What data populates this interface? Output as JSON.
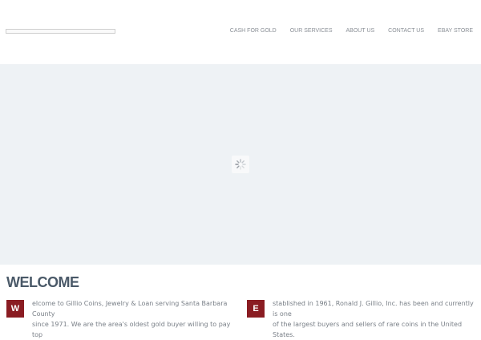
{
  "nav": {
    "items": [
      "CASH FOR GOLD",
      "OUR SERVICES",
      "ABOUT US",
      "CONTACT US",
      "EBAY STORE"
    ]
  },
  "welcome": {
    "title": "WELCOME",
    "col1": {
      "dropcap": "W",
      "line1": "elcome to Gillio Coins, Jewelry & Loan serving Santa Barbara County",
      "line2": "since 1971. We are the area's oldest gold buyer willing to pay top"
    },
    "col2": {
      "dropcap": "E",
      "line1": "stablished in 1961, Ronald J. Gillio, Inc. has been and currently is one",
      "line2": "of the largest buyers and sellers of rare coins in the United States."
    }
  },
  "colors": {
    "accent": "#8a1c22",
    "heading": "#4a5968",
    "hero_bg": "#eef2f5"
  },
  "icons": {
    "loader": "loading-spinner-icon"
  }
}
